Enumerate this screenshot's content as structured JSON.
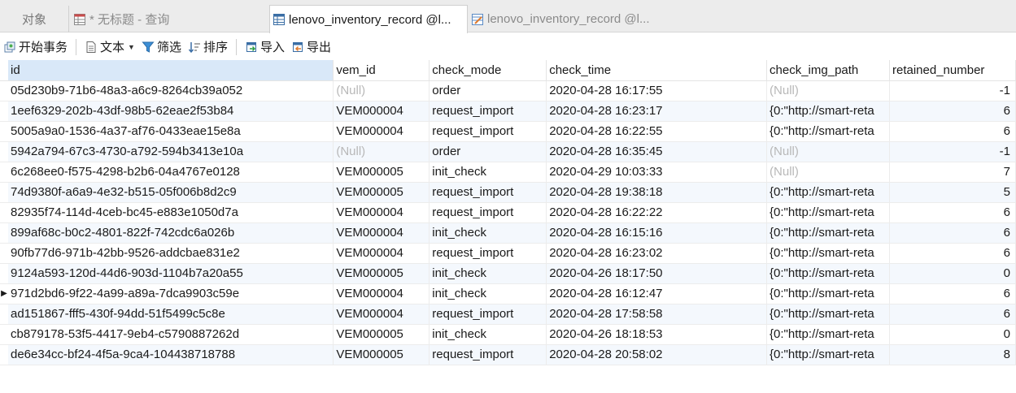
{
  "tabs": [
    {
      "label": "对象",
      "icon": "none"
    },
    {
      "label": "* 无标题 - 查询",
      "icon": "query-table-icon"
    },
    {
      "label": "lenovo_inventory_record @l...",
      "icon": "table-icon",
      "active": true
    },
    {
      "label": "lenovo_inventory_record @l...",
      "icon": "design-table-icon"
    }
  ],
  "toolbar": {
    "begin_transaction": "开始事务",
    "text": "文本",
    "filter": "筛选",
    "sort": "排序",
    "import": "导入",
    "export": "导出"
  },
  "grid": {
    "columns": [
      "id",
      "vem_id",
      "check_mode",
      "check_time",
      "check_img_path",
      "retained_number"
    ],
    "rows": [
      {
        "id": "05d230b9-71b6-48a3-a6c9-8264cb39a052",
        "vem_id": "(Null)",
        "check_mode": "order",
        "check_time": "2020-04-28 16:17:55",
        "check_img_path": "(Null)",
        "retained_number": "-1"
      },
      {
        "id": "1eef6329-202b-43df-98b5-62eae2f53b84",
        "vem_id": "VEM000004",
        "check_mode": "request_import",
        "check_time": "2020-04-28 16:23:17",
        "check_img_path": "{0:\"http://smart-reta",
        "retained_number": "6"
      },
      {
        "id": "5005a9a0-1536-4a37-af76-0433eae15e8a",
        "vem_id": "VEM000004",
        "check_mode": "request_import",
        "check_time": "2020-04-28 16:22:55",
        "check_img_path": "{0:\"http://smart-reta",
        "retained_number": "6"
      },
      {
        "id": "5942a794-67c3-4730-a792-594b3413e10a",
        "vem_id": "(Null)",
        "check_mode": "order",
        "check_time": "2020-04-28 16:35:45",
        "check_img_path": "(Null)",
        "retained_number": "-1"
      },
      {
        "id": "6c268ee0-f575-4298-b2b6-04a4767e0128",
        "vem_id": "VEM000005",
        "check_mode": "init_check",
        "check_time": "2020-04-29 10:03:33",
        "check_img_path": "(Null)",
        "retained_number": "7"
      },
      {
        "id": "74d9380f-a6a9-4e32-b515-05f006b8d2c9",
        "vem_id": "VEM000005",
        "check_mode": "request_import",
        "check_time": "2020-04-28 19:38:18",
        "check_img_path": "{0:\"http://smart-reta",
        "retained_number": "5"
      },
      {
        "id": "82935f74-114d-4ceb-bc45-e883e1050d7a",
        "vem_id": "VEM000004",
        "check_mode": "request_import",
        "check_time": "2020-04-28 16:22:22",
        "check_img_path": "{0:\"http://smart-reta",
        "retained_number": "6"
      },
      {
        "id": "899af68c-b0c2-4801-822f-742cdc6a026b",
        "vem_id": "VEM000004",
        "check_mode": "init_check",
        "check_time": "2020-04-28 16:15:16",
        "check_img_path": "{0:\"http://smart-reta",
        "retained_number": "6"
      },
      {
        "id": "90fb77d6-971b-42bb-9526-addcbae831e2",
        "vem_id": "VEM000004",
        "check_mode": "request_import",
        "check_time": "2020-04-28 16:23:02",
        "check_img_path": "{0:\"http://smart-reta",
        "retained_number": "6"
      },
      {
        "id": "9124a593-120d-44d6-903d-1104b7a20a55",
        "vem_id": "VEM000005",
        "check_mode": "init_check",
        "check_time": "2020-04-26 18:17:50",
        "check_img_path": "{0:\"http://smart-reta",
        "retained_number": "0"
      },
      {
        "id": "971d2bd6-9f22-4a99-a89a-7dca9903c59e",
        "vem_id": "VEM000004",
        "check_mode": "init_check",
        "check_time": "2020-04-28 16:12:47",
        "check_img_path": "{0:\"http://smart-reta",
        "retained_number": "6",
        "current": true
      },
      {
        "id": "ad151867-fff5-430f-94dd-51f5499c5c8e",
        "vem_id": "VEM000004",
        "check_mode": "request_import",
        "check_time": "2020-04-28 17:58:58",
        "check_img_path": "{0:\"http://smart-reta",
        "retained_number": "6"
      },
      {
        "id": "cb879178-53f5-4417-9eb4-c5790887262d",
        "vem_id": "VEM000005",
        "check_mode": "init_check",
        "check_time": "2020-04-26 18:18:53",
        "check_img_path": "{0:\"http://smart-reta",
        "retained_number": "0"
      },
      {
        "id": "de6e34cc-bf24-4f5a-9ca4-104438718788",
        "vem_id": "VEM000005",
        "check_mode": "request_import",
        "check_time": "2020-04-28 20:58:02",
        "check_img_path": "{0:\"http://smart-reta",
        "retained_number": "8"
      }
    ]
  }
}
